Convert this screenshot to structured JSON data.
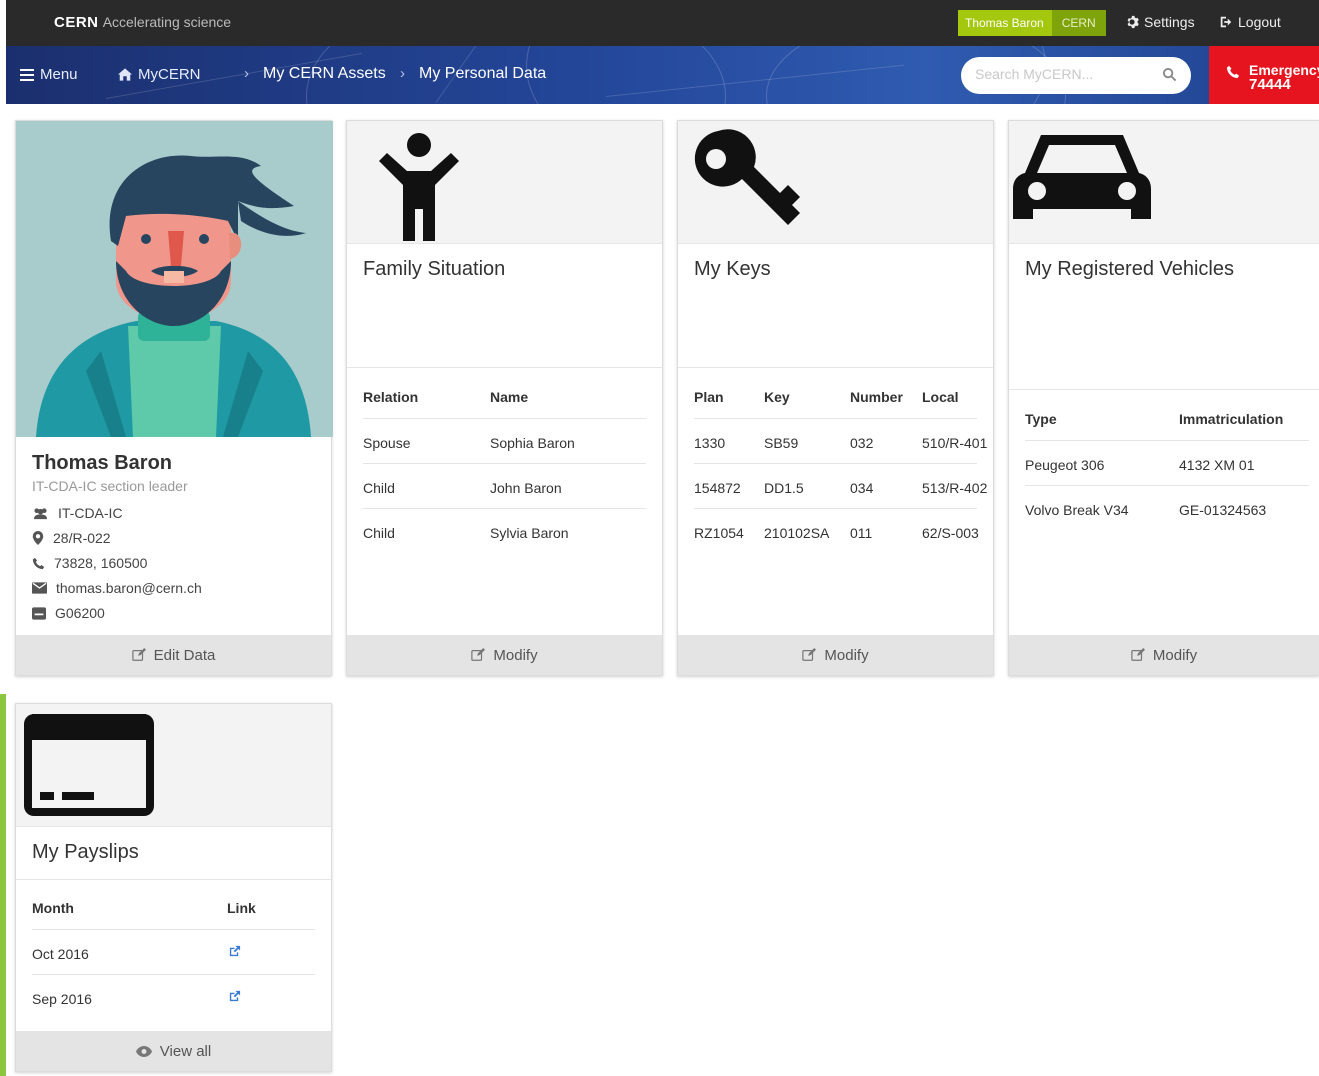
{
  "topbar": {
    "brand": "CERN",
    "tagline": "Accelerating science",
    "user_name": "Thomas Baron",
    "user_org": "CERN",
    "settings_label": "Settings",
    "logout_label": "Logout"
  },
  "navbar": {
    "menu_label": "Menu",
    "home_label": "MyCERN",
    "breadcrumbs": [
      "My CERN Assets",
      "My Personal Data"
    ],
    "search_placeholder": "Search MyCERN...",
    "emergency_label": "Emergency",
    "emergency_number": "74444"
  },
  "profile": {
    "name": "Thomas Baron",
    "role": "IT-CDA-IC section leader",
    "group": "IT-CDA-IC",
    "office": "28/R-022",
    "phone": "73828, 160500",
    "email": "thomas.baron@cern.ch",
    "card_id": "G06200",
    "edit_label": "Edit Data"
  },
  "family": {
    "title": "Family Situation",
    "headers": [
      "Relation",
      "Name"
    ],
    "rows": [
      [
        "Spouse",
        "Sophia Baron"
      ],
      [
        "Child",
        "John Baron"
      ],
      [
        "Child",
        "Sylvia Baron"
      ]
    ],
    "modify_label": "Modify"
  },
  "keys": {
    "title": "My Keys",
    "headers": [
      "Plan",
      "Key",
      "Number",
      "Local"
    ],
    "rows": [
      [
        "1330",
        "SB59",
        "032",
        "510/R-401"
      ],
      [
        "154872",
        "DD1.5",
        "034",
        "513/R-402"
      ],
      [
        "RZ1054",
        "210102SA",
        "011",
        "62/S-003"
      ]
    ],
    "modify_label": "Modify"
  },
  "vehicles": {
    "title": "My Registered Vehicles",
    "headers": [
      "Type",
      "Immatriculation"
    ],
    "rows": [
      [
        "Peugeot 306",
        "4132 XM 01"
      ],
      [
        "Volvo Break V34",
        "GE-01324563"
      ]
    ],
    "modify_label": "Modify"
  },
  "payslips": {
    "title": "My Payslips",
    "headers": [
      "Month",
      "Link"
    ],
    "rows": [
      "Oct 2016",
      "Sep 2016"
    ],
    "view_all_label": "View all"
  },
  "colors": {
    "topbar": "#2a2a2a",
    "user_green": "#a3c80e",
    "emergency_red": "#e6141e",
    "nav_blue": "#24479a",
    "left_strip_green": "#8cc63f"
  }
}
